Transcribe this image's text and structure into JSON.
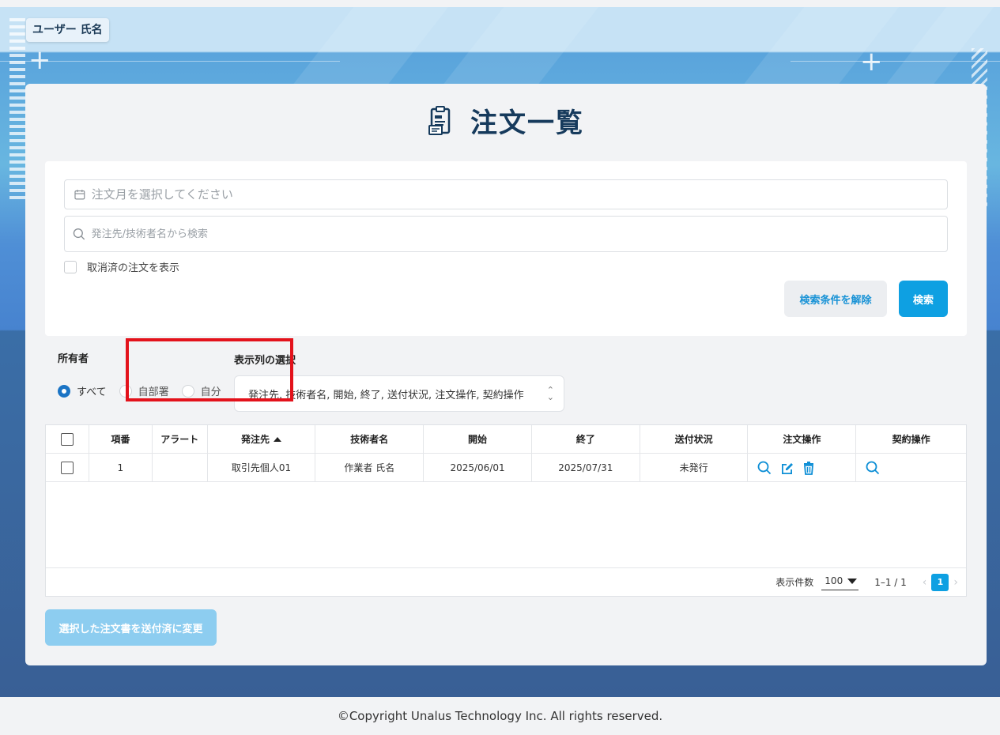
{
  "user": {
    "name": "ユーザー 氏名"
  },
  "page": {
    "title": "注文一覧"
  },
  "search": {
    "month_placeholder": "注文月を選択してください",
    "keyword_placeholder": "発注先/技術者名から検索",
    "show_cancelled_label": "取消済の注文を表示",
    "clear_button": "検索条件を解除",
    "search_button": "検索"
  },
  "owner": {
    "label": "所有者",
    "options": [
      "すべて",
      "自部署",
      "自分"
    ],
    "selected": "すべて"
  },
  "columns_select": {
    "label": "表示列の選択",
    "value": "発注先, 技術者名, 開始, 終了, 送付状況, 注文操作, 契約操作"
  },
  "table": {
    "headers": [
      "",
      "項番",
      "アラート",
      "発注先",
      "技術者名",
      "開始",
      "終了",
      "送付状況",
      "注文操作",
      "契約操作"
    ],
    "sort": {
      "column": "発注先",
      "direction": "asc"
    },
    "rows": [
      {
        "no": "1",
        "alert": "",
        "vendor": "取引先個人01",
        "engineer": "作業者 氏名",
        "start": "2025/06/01",
        "end": "2025/07/31",
        "status": "未発行"
      }
    ]
  },
  "pagination": {
    "per_page_label": "表示件数",
    "per_page": "100",
    "range": "1–1 / 1",
    "current_page": "1"
  },
  "bulk_button": "選択した注文書を送付済に変更",
  "footer": {
    "copyright": "©Copyright Unalus Technology Inc. All rights reserved."
  },
  "colors": {
    "accent": "#0ea0e2",
    "title": "#163a5c",
    "highlight": "#e3121b"
  }
}
